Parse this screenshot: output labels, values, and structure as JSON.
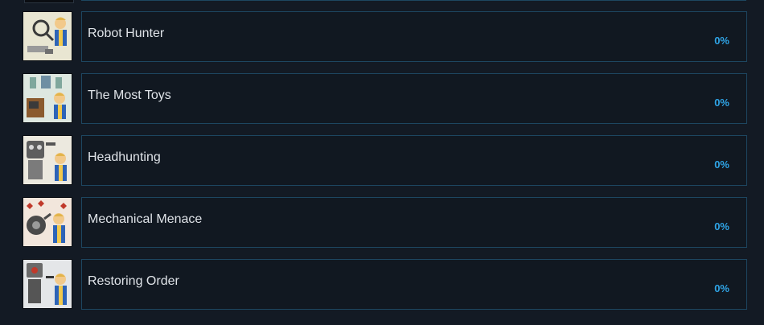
{
  "achievements": [
    {
      "title": "Robot Hunter",
      "percent": "0%",
      "icon": "vault-boy-magnifier-icon"
    },
    {
      "title": "The Most Toys",
      "percent": "0%",
      "icon": "vault-boy-robot-workbench-icon"
    },
    {
      "title": "Headhunting",
      "percent": "0%",
      "icon": "vault-boy-robot-head-icon"
    },
    {
      "title": "Mechanical Menace",
      "percent": "0%",
      "icon": "vault-boy-robot-fight-icon"
    },
    {
      "title": "Restoring Order",
      "percent": "0%",
      "icon": "vault-boy-securitron-icon"
    }
  ],
  "colors": {
    "background": "#131a24",
    "panel_border": "#1d4660",
    "title_text": "#dfe3e8",
    "percent_text": "#2fa4e6"
  }
}
